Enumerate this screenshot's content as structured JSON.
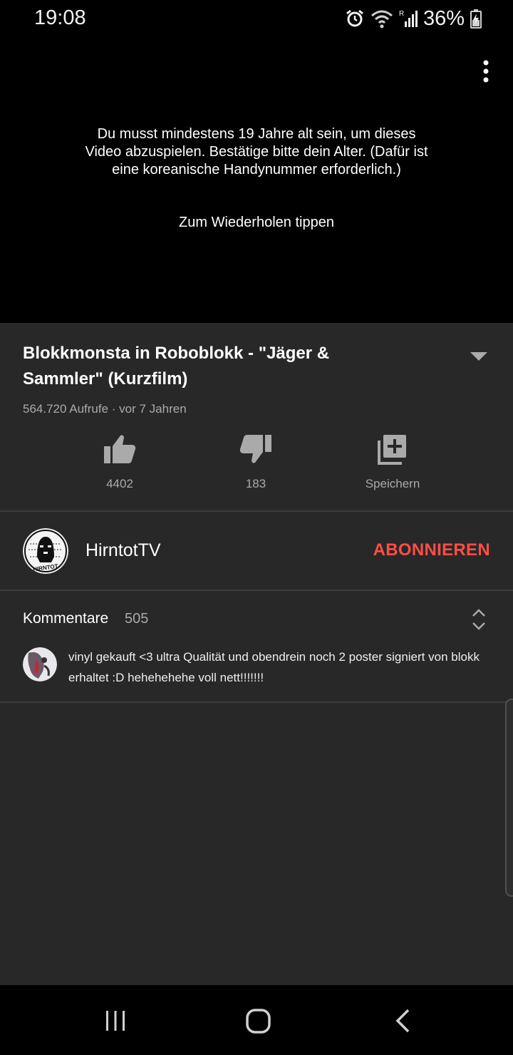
{
  "status_bar": {
    "time": "19:08",
    "battery": "36%",
    "icons": [
      "alarm-icon",
      "wifi-icon",
      "signal-icon",
      "battery-charging-icon"
    ]
  },
  "player": {
    "message": "Du musst mindestens 19 Jahre alt sein, um dieses Video abzuspielen. Bestätige bitte dein Alter. (Dafür ist eine koreanische Handynummer erforderlich.)",
    "retry": "Zum Wiederholen tippen",
    "menu_icon": "more-vert-icon"
  },
  "video": {
    "title": "Blokkmonsta in Roboblokk - \"Jäger & Sammler\" (Kurzfilm)",
    "meta": "564.720 Aufrufe · vor 7 Jahren",
    "expand_icon": "expand-down-icon"
  },
  "actions": [
    {
      "icon": "thumbs-up-icon",
      "label": "4402"
    },
    {
      "icon": "thumbs-down-icon",
      "label": "183"
    },
    {
      "icon": "playlist-add-icon",
      "label": "Speichern"
    }
  ],
  "channel": {
    "name": "HirntotTV",
    "avatar_text": "HIRNTOT",
    "subscribe": "ABONNIEREN",
    "accent": "#ff4e45"
  },
  "comments": {
    "label": "Kommentare",
    "count": "505",
    "top_comment": "vinyl gekauft <3 ultra Qualität und obendrein noch 2 poster signiert von blokk erhaltet :D hehehehehe voll nett!!!!!!!"
  },
  "nav": [
    "recents-icon",
    "home-icon",
    "back-icon"
  ],
  "colors": {
    "background": "#282828",
    "secondary_text": "#aaaaaa",
    "divider": "#3d3d3d"
  }
}
